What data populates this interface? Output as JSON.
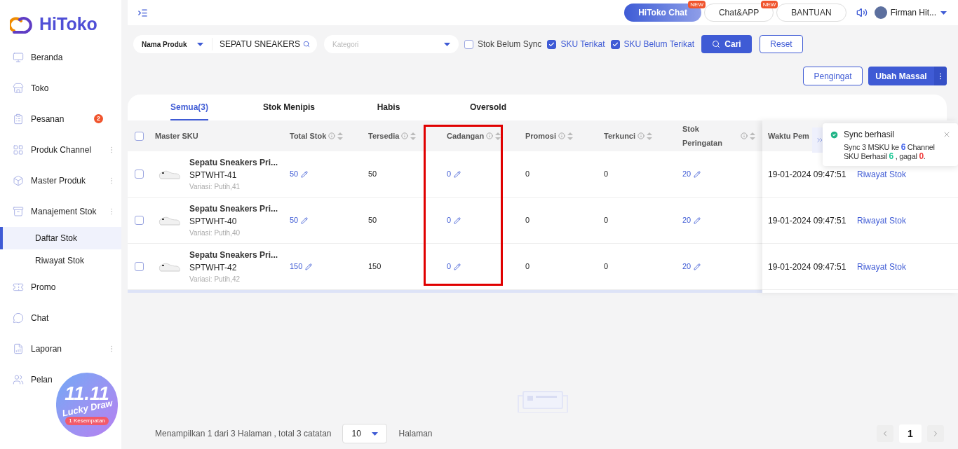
{
  "brand": {
    "name": "HiToko"
  },
  "sidebar": {
    "items": [
      {
        "label": "Beranda",
        "has_menu": false,
        "selected": false
      },
      {
        "label": "Toko",
        "has_menu": false,
        "selected": false
      },
      {
        "label": "Pesanan",
        "badge": "2",
        "has_menu": false,
        "selected": false
      },
      {
        "label": "Produk Channel",
        "has_menu": true,
        "selected": false
      },
      {
        "label": "Master Produk",
        "has_menu": true,
        "selected": false
      },
      {
        "label": "Manajement Stok",
        "has_menu": true,
        "selected": false,
        "children": [
          {
            "label": "Daftar Stok",
            "selected": true
          },
          {
            "label": "Riwayat Stok",
            "selected": false
          }
        ]
      },
      {
        "label": "Promo",
        "has_menu": false,
        "selected": false
      },
      {
        "label": "Chat",
        "has_menu": false,
        "selected": false
      },
      {
        "label": "Laporan",
        "has_menu": true,
        "selected": false
      },
      {
        "label": "Pelan",
        "has_menu": false,
        "selected": false
      }
    ]
  },
  "promo_badge": {
    "title": "11.11",
    "subtitle": "Lucky Draw",
    "note": "1 Kesempatan"
  },
  "topbar": {
    "buttons": [
      {
        "label": "HiToko Chat",
        "kind": "primary",
        "badge": "NEW"
      },
      {
        "label": "Chat&APP",
        "kind": "outline",
        "badge": "NEW"
      },
      {
        "label": "BANTUAN",
        "kind": "outline"
      }
    ],
    "user": "Firman Hit..."
  },
  "filters": {
    "field_select": "Nama Produk",
    "search_value": "SEPATU SNEAKERS",
    "category_placeholder": "Kategori",
    "checkboxes": [
      {
        "label": "Stok Belum Sync",
        "checked": false
      },
      {
        "label": "SKU Terikat",
        "checked": true
      },
      {
        "label": "SKU Belum Terikat",
        "checked": true
      }
    ],
    "search_button": "Cari",
    "reset_button": "Reset"
  },
  "actions": {
    "reminder_button": "Pengingat",
    "bulk_button": "Ubah Massal"
  },
  "tabs": [
    {
      "label": "Semua(3)",
      "selected": true
    },
    {
      "label": "Stok Menipis",
      "selected": false
    },
    {
      "label": "Habis",
      "selected": false
    },
    {
      "label": "Oversold",
      "selected": false
    }
  ],
  "table": {
    "select_all": false,
    "columns": [
      {
        "label": "Master SKU",
        "info": false,
        "sortable": false,
        "editable": false,
        "highlighted": false
      },
      {
        "label": "Total Stok",
        "info": true,
        "sortable": true,
        "editable": true,
        "highlighted": false
      },
      {
        "label": "Tersedia",
        "info": true,
        "sortable": true,
        "editable": false,
        "highlighted": false
      },
      {
        "label": "Cadangan",
        "info": true,
        "sortable": true,
        "editable": true,
        "highlighted": true
      },
      {
        "label": "Promosi",
        "info": true,
        "sortable": true,
        "editable": false,
        "highlighted": false
      },
      {
        "label": "Terkunci",
        "info": true,
        "sortable": true,
        "editable": false,
        "highlighted": false
      },
      {
        "label": "Stok Peringatan",
        "info": true,
        "sortable": true,
        "editable": true,
        "highlighted": false
      }
    ],
    "fixed_column": "Waktu Pem",
    "rows": [
      {
        "selected": false,
        "name": "Sepatu Sneakers Pri...",
        "sku": "SPTWHT-41",
        "variant": "Variasi: Putih,41",
        "values": [
          "50",
          "50",
          "0",
          "0",
          "0",
          "20"
        ],
        "time": "19-01-2024 09:47:51",
        "action": "Riwayat Stok"
      },
      {
        "selected": false,
        "name": "Sepatu Sneakers Pri...",
        "sku": "SPTWHT-40",
        "variant": "Variasi: Putih,40",
        "values": [
          "50",
          "50",
          "0",
          "0",
          "0",
          "20"
        ],
        "time": "19-01-2024 09:47:51",
        "action": "Riwayat Stok"
      },
      {
        "selected": false,
        "name": "Sepatu Sneakers Pri...",
        "sku": "SPTWHT-42",
        "variant": "Variasi: Putih,42",
        "values": [
          "150",
          "150",
          "0",
          "0",
          "0",
          "20"
        ],
        "time": "19-01-2024 09:47:51",
        "action": "Riwayat Stok"
      }
    ]
  },
  "toast": {
    "title": "Sync berhasil",
    "message": [
      {
        "text": "Sync 3 MSKU ke "
      },
      {
        "text": "6",
        "color": "#4263eb"
      },
      {
        "text": " Channel SKU Berhasil "
      },
      {
        "text": "6",
        "color": "#20c997"
      },
      {
        "text": " , gagal "
      },
      {
        "text": "0",
        "color": "#f03e3e"
      },
      {
        "text": "."
      }
    ]
  },
  "footer": {
    "summary": "Menampilkan 1 dari 3 Halaman , total 3 catatan",
    "page_size": "10",
    "page_size_label": "Halaman",
    "pages": [
      {
        "label": "1",
        "selected": true
      }
    ]
  }
}
